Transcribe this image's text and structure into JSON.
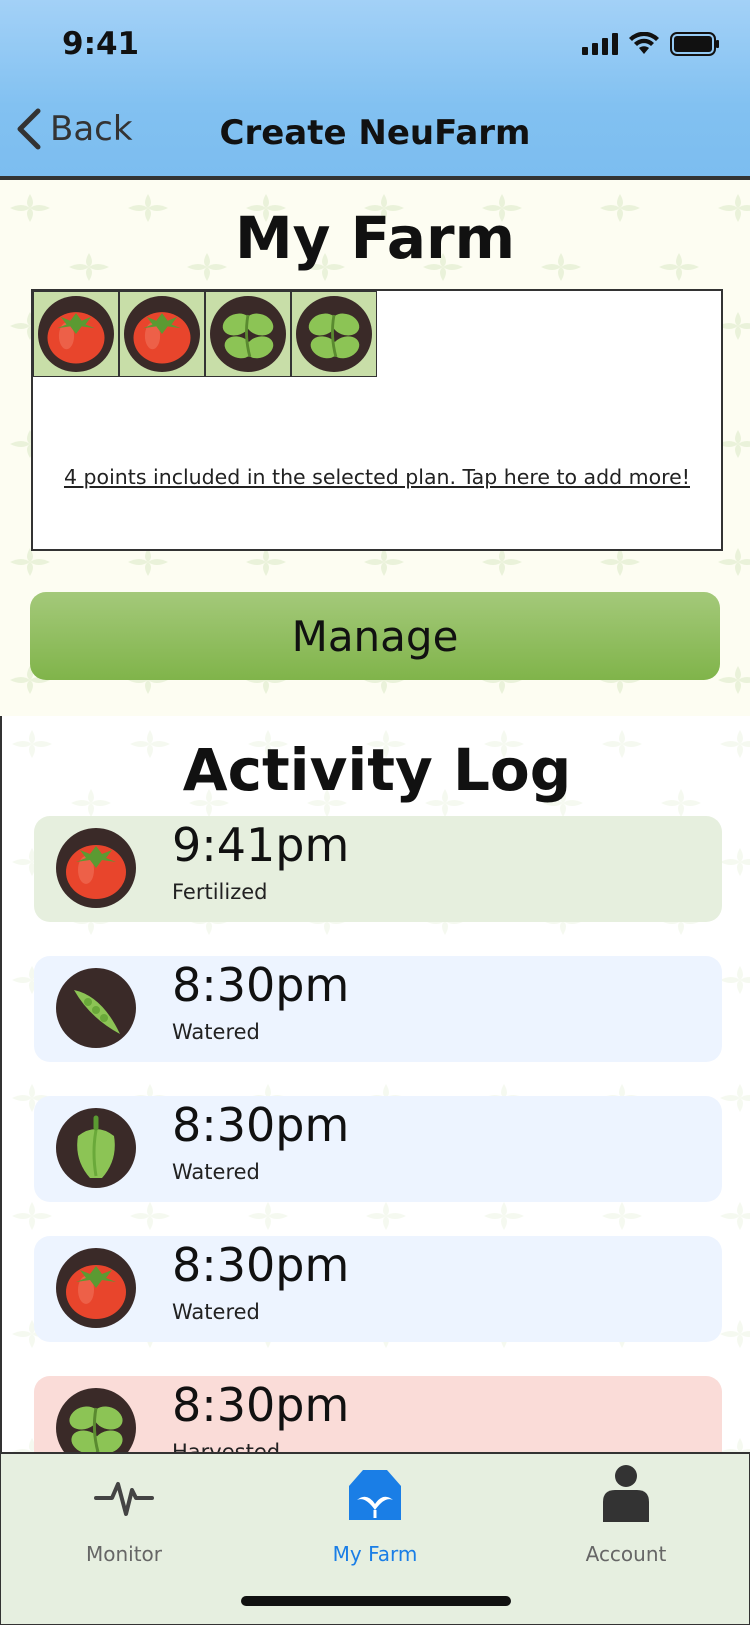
{
  "status_bar": {
    "time": "9:41"
  },
  "nav": {
    "back_label": "Back",
    "title": "Create NeuFarm"
  },
  "farm": {
    "title": "My Farm",
    "cells": [
      {
        "icon": "tomato-icon"
      },
      {
        "icon": "tomato-icon"
      },
      {
        "icon": "seedling-icon"
      },
      {
        "icon": "seedling-icon"
      }
    ],
    "points_link": "4 points included in the selected plan. Tap here to add more!",
    "manage_label": "Manage"
  },
  "activity": {
    "title": "Activity Log",
    "items": [
      {
        "time": "9:41pm",
        "status": "Fertilized",
        "icon": "tomato-icon",
        "color": "#e6efde"
      },
      {
        "time": "8:30pm",
        "status": "Watered",
        "icon": "pea-pod-icon",
        "color": "#edf4ff"
      },
      {
        "time": "8:30pm",
        "status": "Watered",
        "icon": "pepper-icon",
        "color": "#edf4ff"
      },
      {
        "time": "8:30pm",
        "status": "Watered",
        "icon": "tomato-icon",
        "color": "#edf4ff"
      },
      {
        "time": "8:30pm",
        "status": "Harvested",
        "icon": "seedling-icon",
        "color": "#fadcd8"
      }
    ]
  },
  "tabbar": {
    "monitor_label": "Monitor",
    "myfarm_label": "My Farm",
    "account_label": "Account",
    "active_color": "#1a7ee6"
  }
}
